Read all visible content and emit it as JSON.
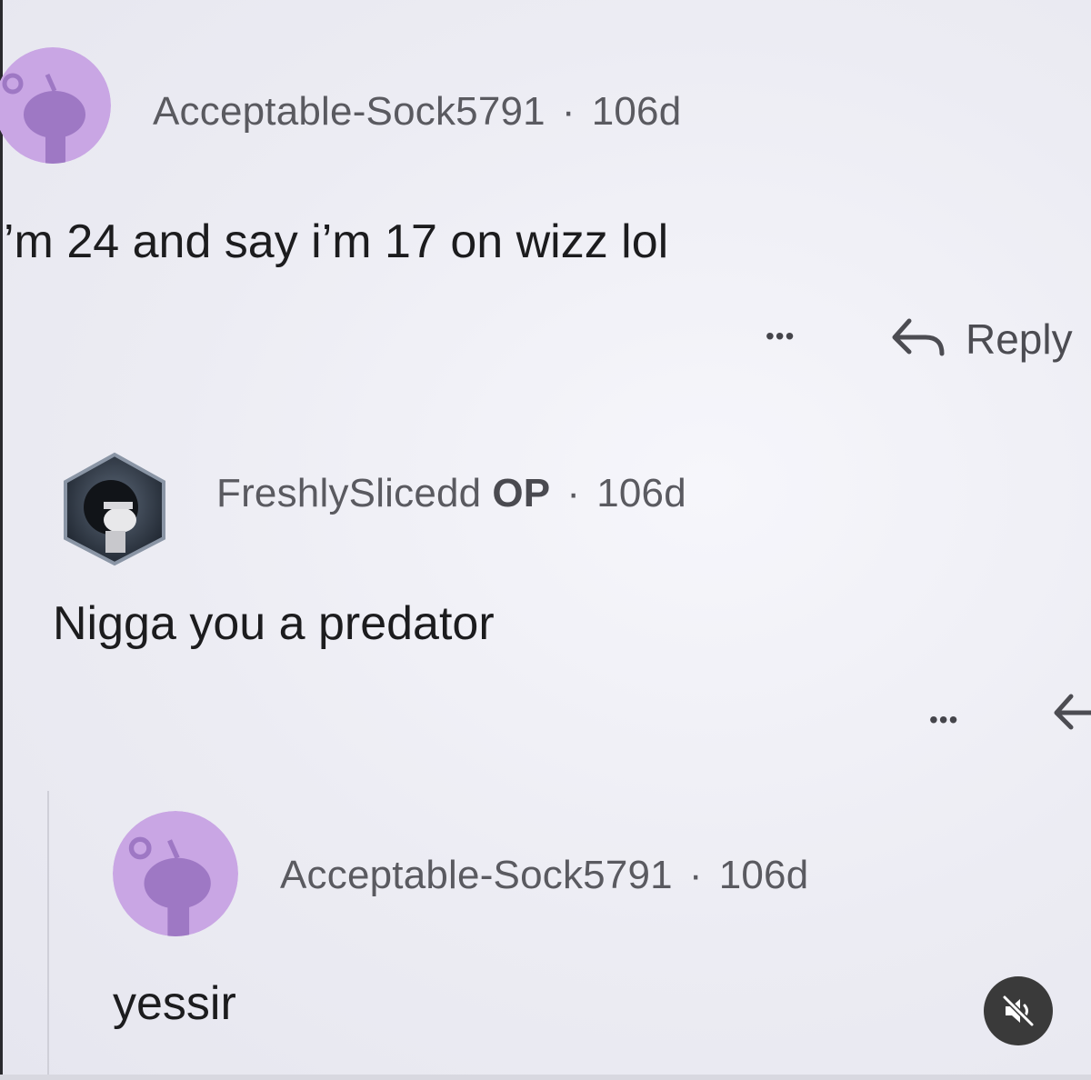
{
  "comments": [
    {
      "username": "Acceptable-Sock5791",
      "separator": "·",
      "age": "106d",
      "text": "’m 24 and say i’m 17 on wizz lol",
      "more_label": "•••",
      "reply_label": "Reply",
      "avatar_icon": "snoo-avatar-icon",
      "avatar_color": "#c9a6e4"
    },
    {
      "username": "FreshlySlicedd",
      "badge": "OP",
      "separator": "·",
      "age": "106d",
      "text": "Nigga you a predator",
      "more_label": "•••",
      "avatar_icon": "custom-avatar-icon"
    },
    {
      "username": "Acceptable-Sock5791",
      "separator": "·",
      "age": "106d",
      "text": "yessir",
      "avatar_icon": "snoo-avatar-icon",
      "avatar_color": "#c9a6e4"
    }
  ],
  "video_controls": {
    "mute_icon": "muted-speaker-icon"
  }
}
